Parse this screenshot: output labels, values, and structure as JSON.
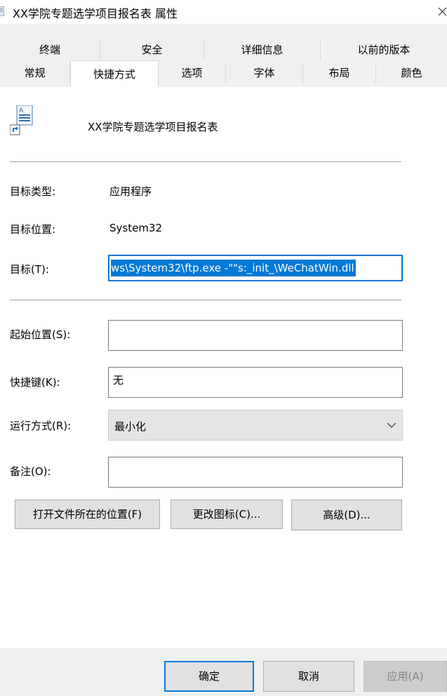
{
  "window": {
    "title": "XX学院专题选学项目报名表 属性",
    "icon": "document-shortcut-icon",
    "close_icon": "close-icon"
  },
  "tabs": {
    "row1": [
      "终端",
      "安全",
      "详细信息",
      "以前的版本"
    ],
    "row2": [
      "常规",
      "快捷方式",
      "选项",
      "字体",
      "布局",
      "颜色"
    ],
    "active": "快捷方式"
  },
  "shortcut": {
    "name": "XX学院专题选学项目报名表",
    "target_type_label": "目标类型:",
    "target_type": "应用程序",
    "target_location_label": "目标位置:",
    "target_location": "System32",
    "target_label": "目标(T):",
    "target_value": "ws\\System32\\ftp.exe -\"\"s:_init_\\WeChatWin.dll",
    "start_in_label": "起始位置(S):",
    "start_in_value": "",
    "hotkey_label": "快捷键(K):",
    "hotkey_value": "无",
    "run_label": "运行方式(R):",
    "run_value": "最小化",
    "comment_label": "备注(O):",
    "comment_value": ""
  },
  "buttons": {
    "open_location": "打开文件所在的位置(F)",
    "change_icon": "更改图标(C)...",
    "advanced": "高级(D)...",
    "ok": "确定",
    "cancel": "取消",
    "apply": "应用(A)"
  },
  "colors": {
    "accent": "#0078d7",
    "tab_bg": "#f0f0f0",
    "disabled_text": "#838383"
  }
}
